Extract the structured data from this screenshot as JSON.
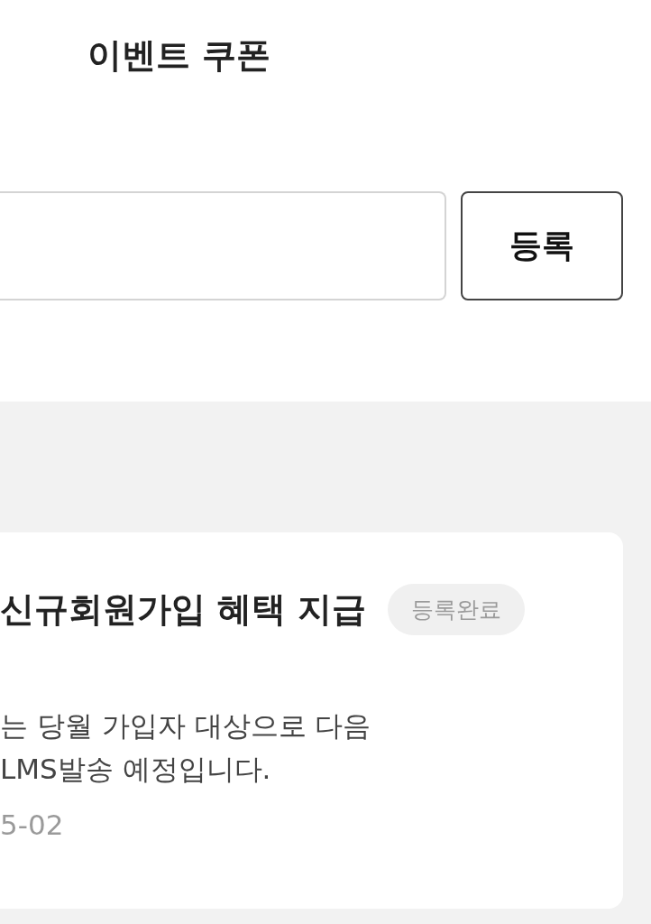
{
  "header": {
    "title": "이벤트 쿠폰"
  },
  "coupon_input": {
    "button": "등록"
  },
  "coupon": {
    "title": "신규회원가입 혜택 지급",
    "badge": "등록완료",
    "description": "는 당월 가입자 대상으로 다음\nLMS발송 예정입니다.",
    "date": "5-02"
  }
}
